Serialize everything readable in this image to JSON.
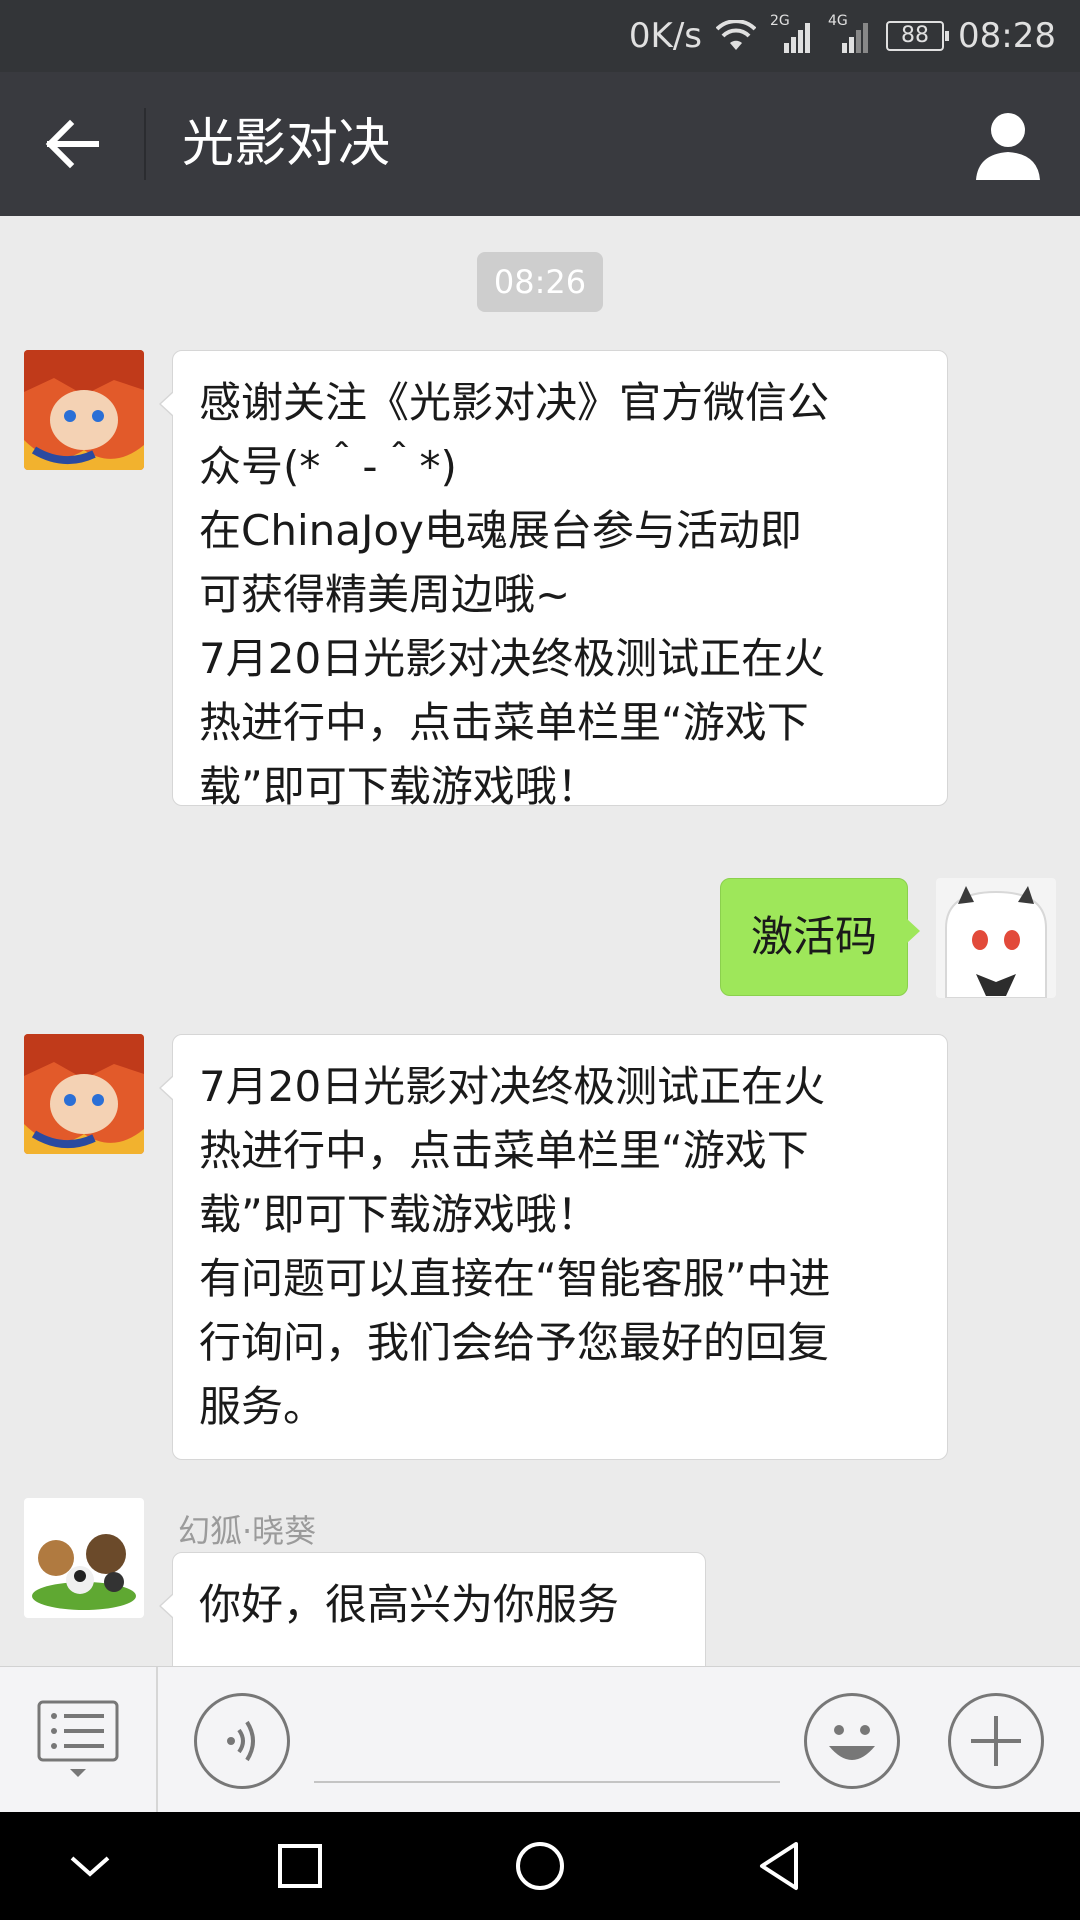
{
  "status_bar": {
    "speed": "0K/s",
    "net1": "2G",
    "net2": "4G",
    "battery": "88",
    "time": "08:28"
  },
  "header": {
    "title": "光影对决"
  },
  "chat": {
    "timestamp": "08:26",
    "msg1": "感谢关注《光影对决》官方微信公\n众号(*＾-＾*)\n在ChinaJoy电魂展台参与活动即\n可获得精美周边哦~\n7月20日光影对决终极测试正在火\n热进行中，点击菜单栏里“游戏下\n载”即可下载游戏哦！",
    "msg2": "激活码",
    "msg3": "7月20日光影对决终极测试正在火\n热进行中，点击菜单栏里“游戏下\n载”即可下载游戏哦！\n有问题可以直接在“智能客服”中进\n行询问，我们会给予您最好的回复\n服务。",
    "agent_name": "幻狐·晓葵",
    "msg4": "你好，很高兴为你服务"
  },
  "input": {
    "placeholder": ""
  },
  "colors": {
    "titlebar": "#393a3f",
    "chat_bg": "#ebebeb",
    "out_bubble": "#9ee75a"
  }
}
